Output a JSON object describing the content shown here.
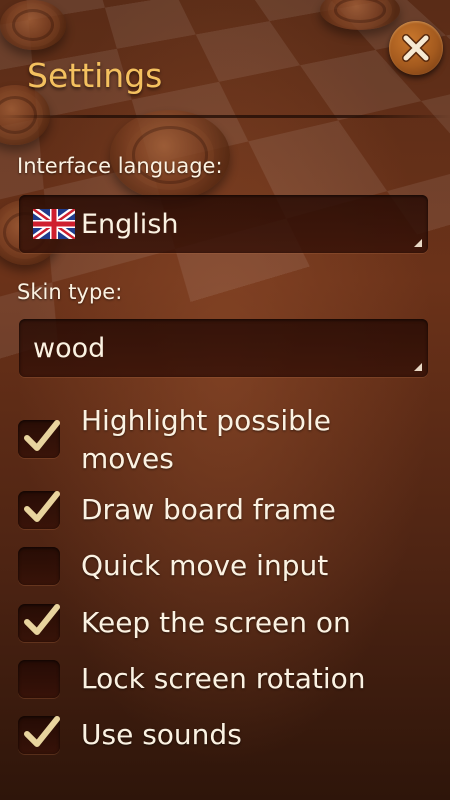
{
  "header": {
    "title": "Settings"
  },
  "close": {
    "icon": "close-icon"
  },
  "language": {
    "label": "Interface language:",
    "value": "English",
    "flag_icon": "uk-flag-icon"
  },
  "skin": {
    "label": "Skin type:",
    "value": "wood"
  },
  "options": [
    {
      "label_line1": "Highlight possible",
      "label_line2": "moves",
      "checked": true
    },
    {
      "label": "Draw board frame",
      "checked": true
    },
    {
      "label": "Quick move input",
      "checked": false
    },
    {
      "label": "Keep the screen on",
      "checked": true
    },
    {
      "label": "Lock screen rotation",
      "checked": false
    },
    {
      "label": "Use sounds",
      "checked": true
    }
  ],
  "colors": {
    "title": "#f4c15f",
    "text": "#fbf2e2",
    "check": "#e8d49e"
  }
}
